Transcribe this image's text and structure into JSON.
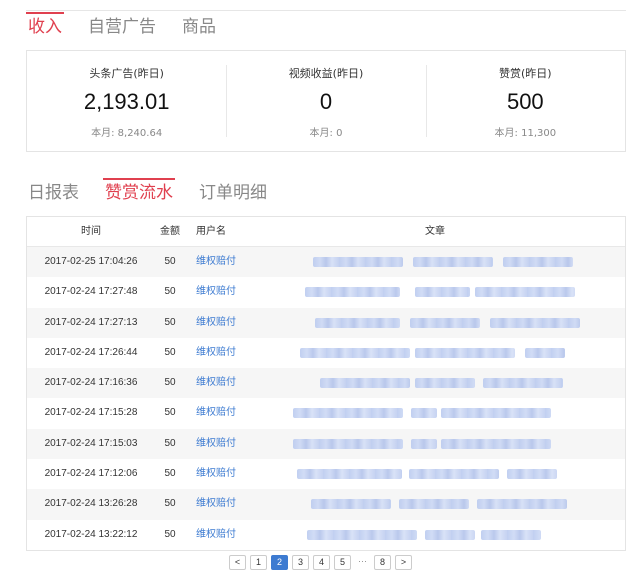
{
  "main_tabs": [
    {
      "label": "收入",
      "active": true
    },
    {
      "label": "自营广告",
      "active": false
    },
    {
      "label": "商品",
      "active": false
    }
  ],
  "stats": [
    {
      "label": "头条广告(昨日)",
      "value": "2,193.01",
      "month": "本月: 8,240.64"
    },
    {
      "label": "视频收益(昨日)",
      "value": "0",
      "month": "本月: 0"
    },
    {
      "label": "赞赏(昨日)",
      "value": "500",
      "month": "本月: 11,300"
    }
  ],
  "sub_tabs": [
    {
      "label": "日报表",
      "active": false
    },
    {
      "label": "赞赏流水",
      "active": true
    },
    {
      "label": "订单明细",
      "active": false
    }
  ],
  "table": {
    "headers": {
      "time": "时间",
      "amount": "金额",
      "user": "用户名",
      "article": "文章"
    },
    "rows": [
      {
        "time": "2017-02-25 17:04:26",
        "amount": "50",
        "user": "维权赔付"
      },
      {
        "time": "2017-02-24 17:27:48",
        "amount": "50",
        "user": "维权赔付"
      },
      {
        "time": "2017-02-24 17:27:13",
        "amount": "50",
        "user": "维权赔付"
      },
      {
        "time": "2017-02-24 17:26:44",
        "amount": "50",
        "user": "维权赔付"
      },
      {
        "time": "2017-02-24 17:16:36",
        "amount": "50",
        "user": "维权赔付"
      },
      {
        "time": "2017-02-24 17:15:28",
        "amount": "50",
        "user": "维权赔付"
      },
      {
        "time": "2017-02-24 17:15:03",
        "amount": "50",
        "user": "维权赔付"
      },
      {
        "time": "2017-02-24 17:12:06",
        "amount": "50",
        "user": "维权赔付"
      },
      {
        "time": "2017-02-24 13:26:28",
        "amount": "50",
        "user": "维权赔付"
      },
      {
        "time": "2017-02-24 13:22:12",
        "amount": "50",
        "user": "维权赔付"
      }
    ]
  },
  "pagination": {
    "prev": "<",
    "pages": [
      "1",
      "2",
      "3",
      "4",
      "5"
    ],
    "current": "2",
    "ellipsis": "···",
    "last": "8",
    "next": ">"
  },
  "colors": {
    "accent": "#e0404f",
    "link": "#3d7bd1",
    "blurred_text": "#c2d0f2"
  }
}
